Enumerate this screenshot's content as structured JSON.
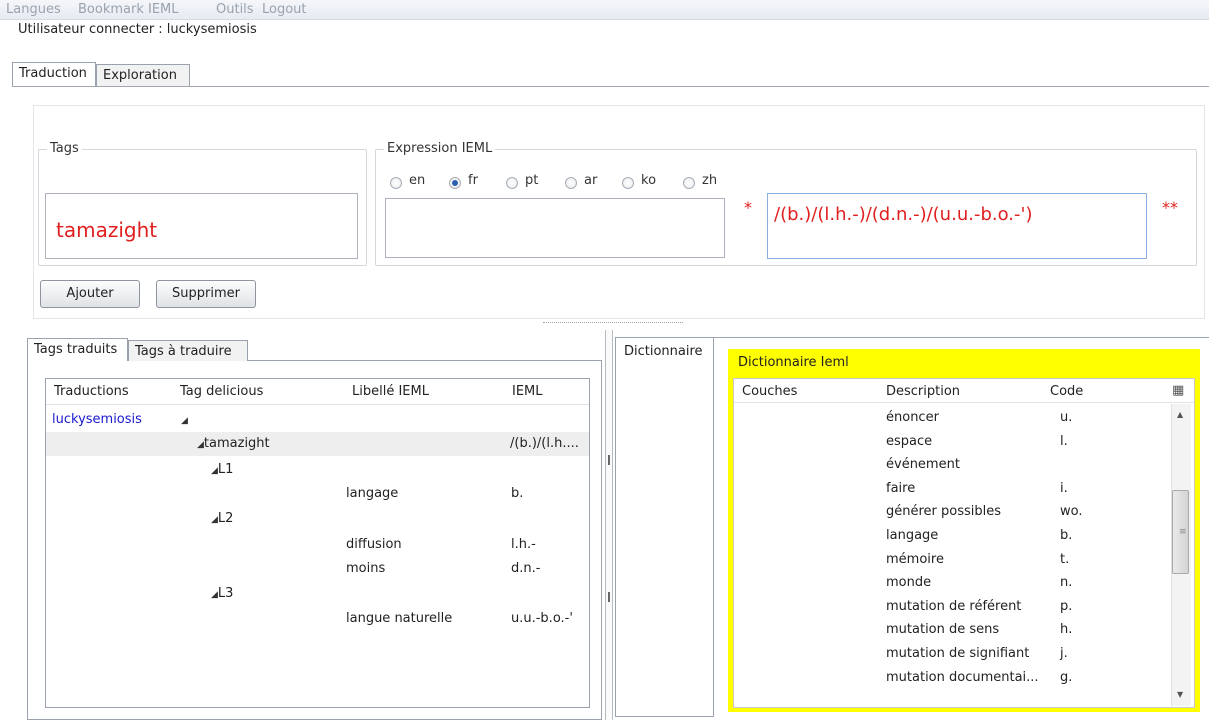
{
  "menu": [
    "Langues",
    "Bookmark IEML",
    "Outils",
    "Logout"
  ],
  "user_line": "Utilisateur connecter : luckysemiosis",
  "top_tabs": [
    "Traduction",
    "Exploration"
  ],
  "form": {
    "tags_title": "Tags",
    "tags_value": "tamazight",
    "expr_title": "Expression IEML",
    "languages": [
      "en",
      "fr",
      "pt",
      "ar",
      "ko",
      "zh"
    ],
    "selected_language": "fr",
    "expr_text": "",
    "required_marker": "*",
    "ieml_value": "/(b.)/(l.h.-)/(d.n.-)/(u.u.-b.o.-')",
    "ieml_marker": "**",
    "add_button": "Ajouter",
    "delete_button": "Supprimer"
  },
  "bottom_tabs": [
    "Tags traduits",
    "Tags à traduire"
  ],
  "tree": {
    "columns": [
      "Traductions",
      "Tag delicious",
      "Libellé IEML",
      "IEML"
    ],
    "user": "luckysemiosis",
    "tag": "tamazight",
    "tag_ieml": "/(b.)/(l.h....",
    "layers": [
      {
        "name": "L1",
        "items": [
          {
            "label": "langage",
            "code": "b."
          }
        ]
      },
      {
        "name": "L2",
        "items": [
          {
            "label": "diffusion",
            "code": "l.h.-"
          },
          {
            "label": "moins",
            "code": "d.n.-"
          }
        ]
      },
      {
        "name": "L3",
        "items": [
          {
            "label": "langue naturelle",
            "code": "u.u.-b.o.-'"
          }
        ]
      }
    ]
  },
  "dictionary": {
    "tab_label": "Dictionnaire",
    "title": "Dictionnaire Ieml",
    "columns": [
      "Couches",
      "Description",
      "Code"
    ],
    "rows": [
      {
        "description": "énoncer",
        "code": "u."
      },
      {
        "description": "espace",
        "code": "l."
      },
      {
        "description": "événement",
        "code": ""
      },
      {
        "description": "faire",
        "code": "i."
      },
      {
        "description": "générer possibles",
        "code": "wo."
      },
      {
        "description": "langage",
        "code": "b."
      },
      {
        "description": "mémoire",
        "code": "t."
      },
      {
        "description": "monde",
        "code": "n."
      },
      {
        "description": "mutation de référent",
        "code": "p."
      },
      {
        "description": "mutation de sens",
        "code": "h."
      },
      {
        "description": "mutation de signifiant",
        "code": "j."
      },
      {
        "description": "mutation documentai...",
        "code": "g."
      }
    ]
  }
}
